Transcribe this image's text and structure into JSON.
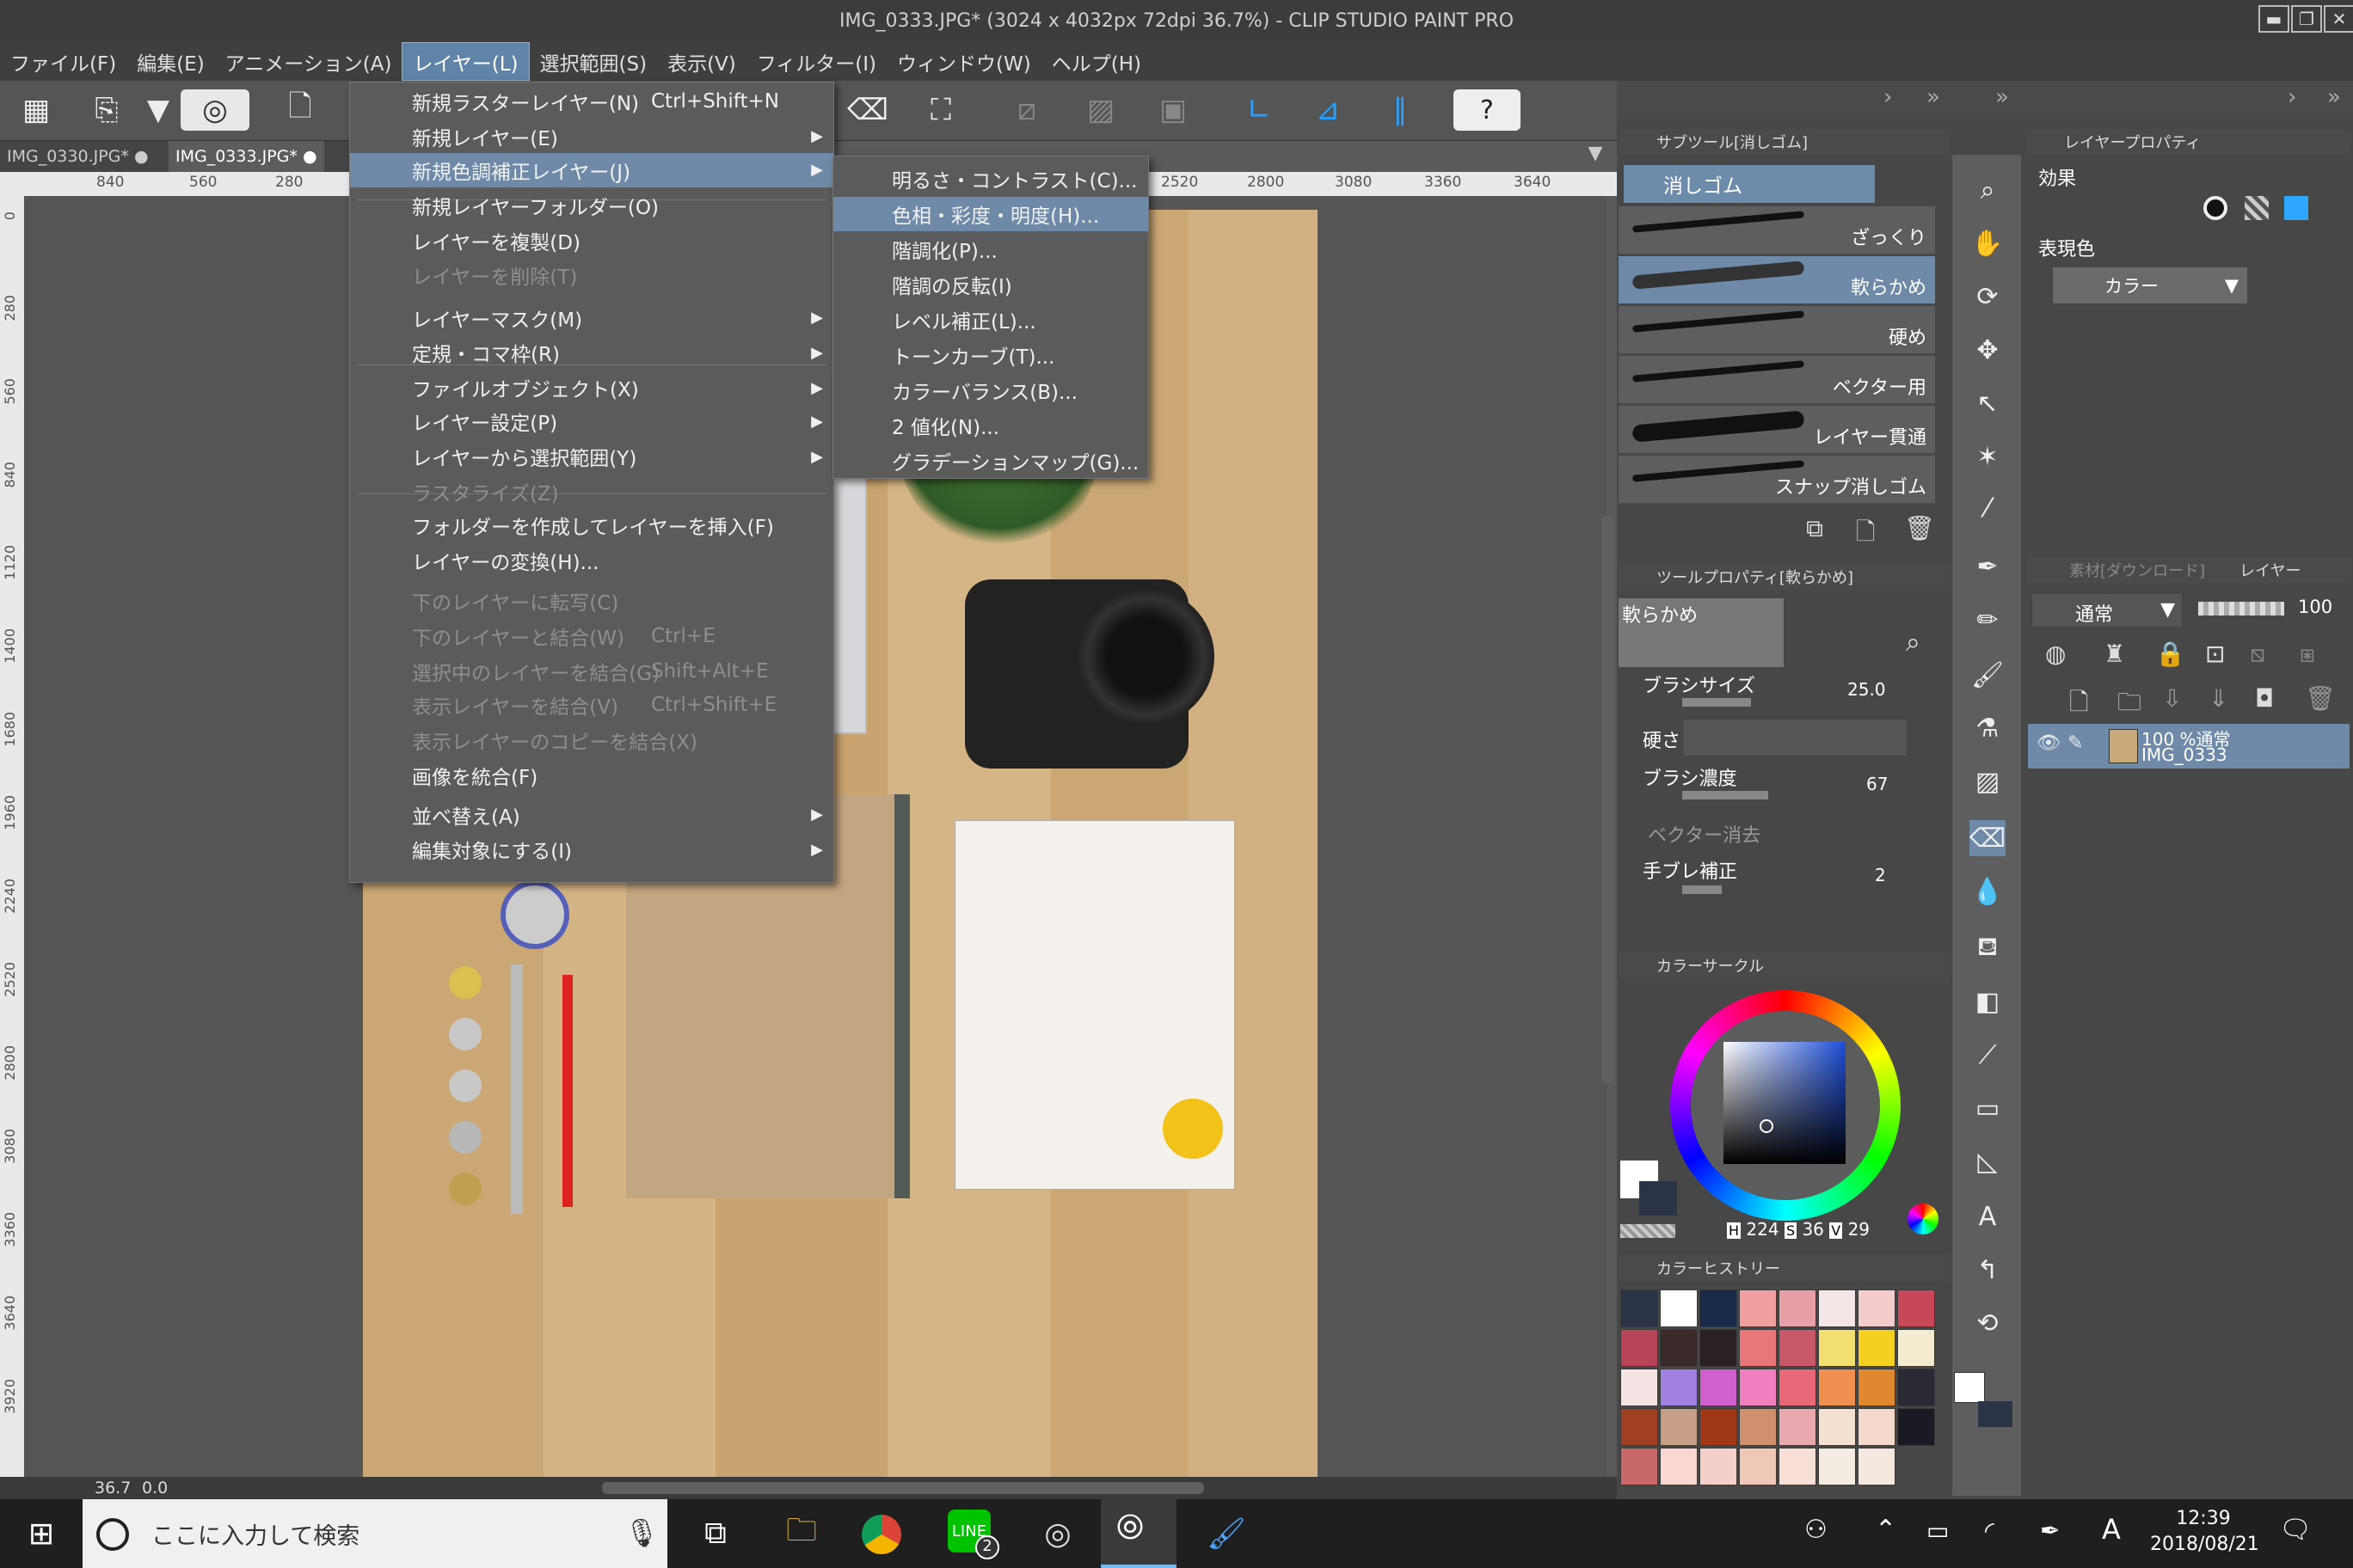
{
  "window": {
    "title": "IMG_0333.JPG* (3024 x 4032px 72dpi 36.7%)  - CLIP STUDIO PAINT PRO"
  },
  "menubar": [
    "ファイル(F)",
    "編集(E)",
    "アニメーション(A)",
    "レイヤー(L)",
    "選択範囲(S)",
    "表示(V)",
    "フィルター(I)",
    "ウィンドウ(W)",
    "ヘルプ(H)"
  ],
  "tabs": [
    "IMG_0330.JPG*",
    "IMG_0333.JPG*"
  ],
  "ruler_top": [
    "840",
    "560",
    "280",
    "2520",
    "2800",
    "3080",
    "3360",
    "3640"
  ],
  "ruler_left": [
    "0",
    "280",
    "560",
    "840",
    "1120",
    "1400",
    "1680",
    "1960",
    "2240",
    "2520",
    "2800",
    "3080",
    "3360",
    "3640",
    "3920"
  ],
  "status": {
    "zoom": "36.7",
    "angle": "0.0"
  },
  "layer_menu": [
    {
      "label": "新規ラスターレイヤー(N)",
      "shortcut": "Ctrl+Shift+N"
    },
    {
      "label": "新規レイヤー(E)",
      "arrow": "▶"
    },
    {
      "label": "新規色調補正レイヤー(J)",
      "arrow": "▶"
    },
    {
      "label": "新規レイヤーフォルダー(O)"
    },
    {
      "label": "レイヤーを複製(D)"
    },
    {
      "label": "レイヤーを削除(T)"
    },
    {
      "label": "レイヤーマスク(M)",
      "arrow": "▶"
    },
    {
      "label": "定規・コマ枠(R)",
      "arrow": "▶"
    },
    {
      "label": "ファイルオブジェクト(X)",
      "arrow": "▶"
    },
    {
      "label": "レイヤー設定(P)",
      "arrow": "▶"
    },
    {
      "label": "レイヤーから選択範囲(Y)",
      "arrow": "▶"
    },
    {
      "label": "ラスタライズ(Z)"
    },
    {
      "label": "フォルダーを作成してレイヤーを挿入(F)"
    },
    {
      "label": "レイヤーの変換(H)..."
    },
    {
      "label": "下のレイヤーに転写(C)"
    },
    {
      "label": "下のレイヤーと結合(W)",
      "shortcut": "Ctrl+E"
    },
    {
      "label": "選択中のレイヤーを結合(G)",
      "shortcut": "Shift+Alt+E"
    },
    {
      "label": "表示レイヤーを結合(V)",
      "shortcut": "Ctrl+Shift+E"
    },
    {
      "label": "表示レイヤーのコピーを結合(X)"
    },
    {
      "label": "画像を統合(F)"
    },
    {
      "label": "並べ替え(A)",
      "arrow": "▶"
    },
    {
      "label": "編集対象にする(I)",
      "arrow": "▶"
    }
  ],
  "submenu": [
    "明るさ・コントラスト(C)...",
    "色相・彩度・明度(H)...",
    "階調化(P)...",
    "階調の反転(I)",
    "レベル補正(L)...",
    "トーンカーブ(T)...",
    "カラーバランス(B)...",
    "2 値化(N)...",
    "グラデーションマップ(G)..."
  ],
  "subtool": {
    "header": "サブツール[消しゴム]",
    "group": "消しゴム",
    "brushes": [
      "ざっくり",
      "軟らかめ",
      "硬め",
      "ベクター用",
      "レイヤー貫通",
      "スナップ消しゴム"
    ]
  },
  "layer_prop": {
    "header": "レイヤープロパティ",
    "effect": "効果",
    "expr": "表現色",
    "color_mode": "カラー"
  },
  "tool_prop": {
    "header": "ツールプロパティ[軟らかめ]",
    "name": "軟らかめ",
    "brush_size_label": "ブラシサイズ",
    "brush_size": "25.0",
    "hardness": "硬さ",
    "density_label": "ブラシ濃度",
    "density": "67",
    "vector_erase": "ベクター消去",
    "stabilizer_label": "手ブレ補正",
    "stabilizer": "2"
  },
  "layer_panel": {
    "tab1": "素材[ダウンロード]",
    "tab2": "レイヤー",
    "blend": "通常",
    "opacity": "100",
    "layer_mode": "100 %通常",
    "layer_name": "IMG_0333"
  },
  "color_circle": {
    "header": "カラーサークル",
    "h_label": "H",
    "h": "224",
    "s_label": "S",
    "s": "36",
    "v_label": "V",
    "v": "29"
  },
  "color_history": {
    "header": "カラーヒストリー",
    "swatches": [
      "#2b3347",
      "#ffffff",
      "#1a2a4a",
      "#f0a0a0",
      "#e8a0a8",
      "#f4e6e6",
      "#f4cccc",
      "#c8485a",
      "#b84458",
      "#3a2a2a",
      "#2a2222",
      "#e87878",
      "#c85868",
      "#f4e070",
      "#f4d020",
      "#f4ecd0",
      "#f4e4e4",
      "#a080e0",
      "#d060d0",
      "#f080c0",
      "#e86878",
      "#f09050",
      "#e08830",
      "#2a2a34",
      "#a04020",
      "#c8a088",
      "#a03818",
      "#d09070",
      "#e8a8b0",
      "#f4e0d0",
      "#f4d8cc",
      "#1a1a22",
      "#c86868",
      "#f8d8d0",
      "#f4d0c8",
      "#f0c8b8",
      "#f8e0d8",
      "#f4ece0",
      "#f4e8e0"
    ]
  },
  "taskbar": {
    "search": "ここに入力して検索",
    "badge": "2",
    "time": "12:39",
    "date": "2018/08/21",
    "ime": "A"
  }
}
